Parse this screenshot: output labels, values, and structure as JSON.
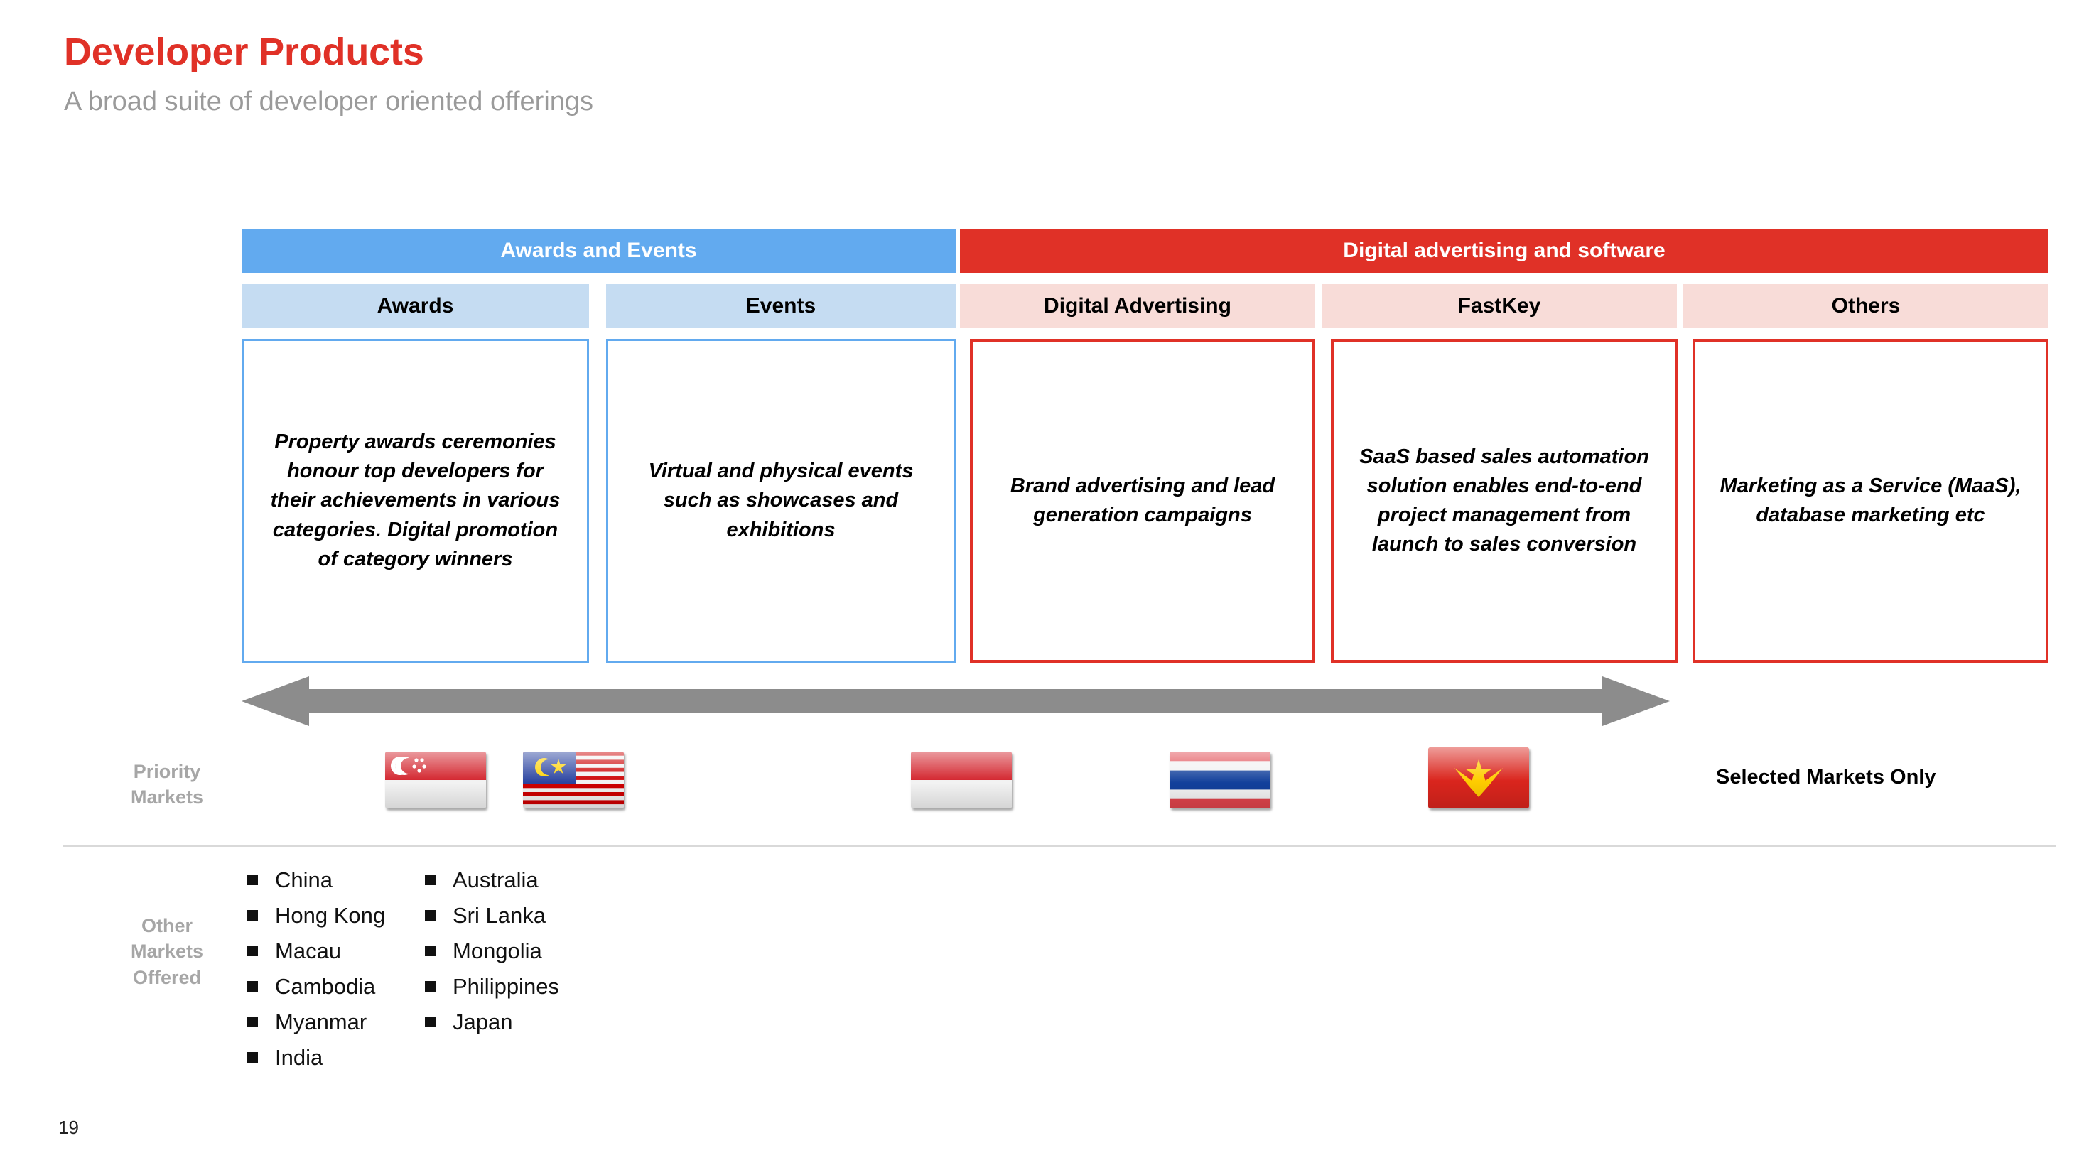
{
  "header": {
    "title": "Developer Products",
    "subtitle": "A broad suite of developer oriented offerings",
    "title_color": "#E03127",
    "subtitle_color": "#9A9A9A"
  },
  "colors": {
    "blue": "#62AAEF",
    "blue_light": "#C5DCF2",
    "red": "#E03127",
    "red_light": "#F8DCD8",
    "gray_arrow": "#8C8C8C",
    "gray_label": "#A6A6A6"
  },
  "categories": [
    {
      "label": "Awards and Events",
      "theme": "blue"
    },
    {
      "label": "Digital advertising and software",
      "theme": "red"
    }
  ],
  "columns": [
    {
      "heading": "Awards",
      "theme": "blue",
      "body": "Property awards ceremonies honour top developers for their achievements in various categories. Digital promotion of category winners",
      "flag": "singapore-flag"
    },
    {
      "heading": "Events",
      "theme": "blue",
      "body": "Virtual and physical events such as showcases and exhibitions",
      "flag": "malaysia-flag"
    },
    {
      "heading": "Digital Advertising",
      "theme": "red",
      "body": "Brand advertising and lead generation campaigns",
      "flag": "indonesia-flag"
    },
    {
      "heading": "FastKey",
      "theme": "red",
      "body": "SaaS based sales automation solution enables end-to-end project management from launch to sales conversion",
      "flag": "thailand-flag"
    },
    {
      "heading": "Others",
      "theme": "red",
      "body": "Marketing as a Service (MaaS), database marketing etc",
      "flag": "vietnam-flag"
    }
  ],
  "arrow": {
    "icon": "double-headed-arrow-icon"
  },
  "priority_markets": {
    "label_line1": "Priority",
    "label_line2": "Markets",
    "note": "Selected Markets Only",
    "flags": [
      {
        "name": "singapore-flag",
        "country": "Singapore"
      },
      {
        "name": "malaysia-flag",
        "country": "Malaysia"
      },
      {
        "name": "indonesia-flag",
        "country": "Indonesia"
      },
      {
        "name": "thailand-flag",
        "country": "Thailand"
      },
      {
        "name": "vietnam-flag",
        "country": "Vietnam"
      }
    ]
  },
  "other_markets": {
    "label_line1": "Other",
    "label_line2": "Markets",
    "label_line3": "Offered",
    "column1": [
      "China",
      "Hong Kong",
      "Macau",
      "Cambodia",
      "Myanmar",
      "India"
    ],
    "column2": [
      "Australia",
      "Sri Lanka",
      "Mongolia",
      "Philippines",
      "Japan"
    ]
  },
  "footer": {
    "page_number": "19"
  }
}
